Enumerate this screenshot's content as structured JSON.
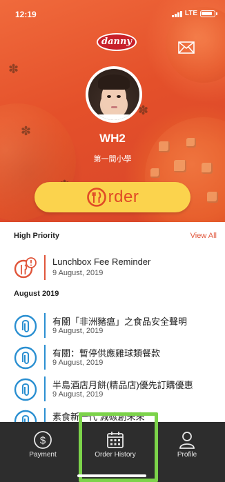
{
  "status_bar": {
    "time": "12:19",
    "network": "LTE"
  },
  "brand": {
    "logo_text": "danny",
    "accent_color": "#e0553a",
    "button_color": "#fbd34d",
    "highlight_color": "#7cd34a"
  },
  "header": {
    "mail_icon": "envelope-icon",
    "avatar_icon": "student-photo",
    "student_name": "WH2",
    "school_name": "第一間小學"
  },
  "order_button": {
    "label": "rder",
    "icon": "fork-knife-o-icon"
  },
  "high_priority": {
    "title": "High Priority",
    "view_all": "View All",
    "items": [
      {
        "title": "Lunchbox Fee Reminder",
        "date": "9 August, 2019",
        "icon": "alert-food-icon"
      }
    ]
  },
  "august": {
    "title": "August 2019",
    "items": [
      {
        "title": "有關「非洲豬瘟」之食品安全聲明",
        "date": "9 August, 2019",
        "icon": "paperclip-icon"
      },
      {
        "title": "有關：暫停供應雞球類餐款",
        "date": "9 August, 2019",
        "icon": "paperclip-icon"
      },
      {
        "title": "半島酒店月餅(精品店)優先訂購優惠",
        "date": "9 August, 2019",
        "icon": "paperclip-icon"
      },
      {
        "title": "素食新一代 減碳創未來",
        "date": "",
        "icon": "paperclip-icon"
      }
    ]
  },
  "tab_bar": {
    "payment": "Payment",
    "order_history": "Order History",
    "profile": "Profile"
  }
}
